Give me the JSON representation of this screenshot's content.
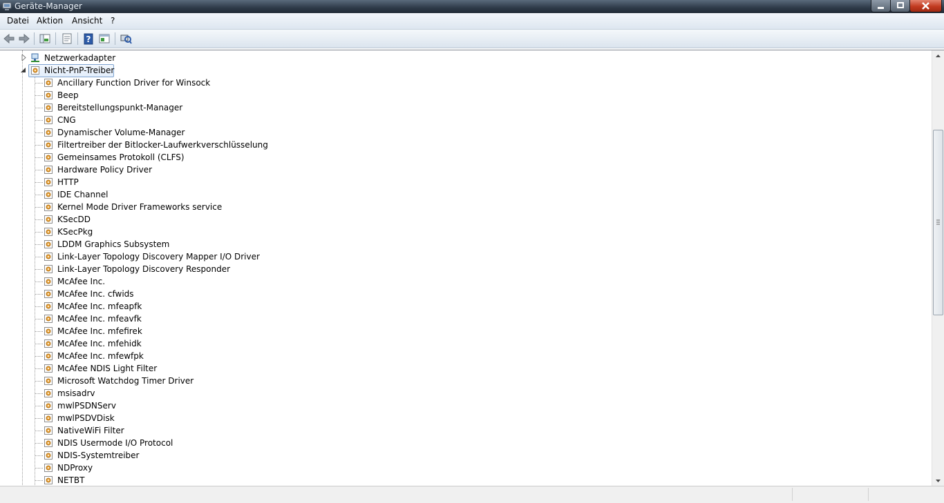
{
  "window": {
    "title": "Geräte-Manager",
    "buttons": [
      "minimize-button",
      "maximize-button",
      "close-button"
    ]
  },
  "menu": [
    "Datei",
    "Aktion",
    "Ansicht",
    "?"
  ],
  "toolbar": [
    "back-icon",
    "forward-icon",
    "tree-view-icon",
    "properties-icon",
    "help-icon",
    "console-tree-icon",
    "scan-hardware-icon"
  ],
  "tree": {
    "collapsed_category": "Netzwerkadapter",
    "expanded_category": "Nicht-PnP-Treiber",
    "items": [
      "Ancillary Function Driver for Winsock",
      "Beep",
      "Bereitstellungspunkt-Manager",
      "CNG",
      "Dynamischer Volume-Manager",
      "Filtertreiber der Bitlocker-Laufwerkverschlüsselung",
      "Gemeinsames Protokoll (CLFS)",
      "Hardware Policy Driver",
      "HTTP",
      "IDE Channel",
      "Kernel Mode Driver Frameworks service",
      "KSecDD",
      "KSecPkg",
      "LDDM Graphics Subsystem",
      "Link-Layer Topology Discovery Mapper I/O Driver",
      "Link-Layer Topology Discovery Responder",
      "McAfee Inc.",
      "McAfee Inc. cfwids",
      "McAfee Inc. mfeapfk",
      "McAfee Inc. mfeavfk",
      "McAfee Inc. mfefirek",
      "McAfee Inc. mfehidk",
      "McAfee Inc. mfewfpk",
      "McAfee NDIS Light Filter",
      "Microsoft Watchdog Timer Driver",
      "msisadrv",
      "mwlPSDNServ",
      "mwlPSDVDisk",
      "NativeWiFi Filter",
      "NDIS Usermode I/O Protocol",
      "NDIS-Systemtreiber",
      "NDProxy",
      "NETBT"
    ]
  },
  "colors": {
    "selection_border": "#7da2ce",
    "driver_icon": "#e8a33a"
  }
}
